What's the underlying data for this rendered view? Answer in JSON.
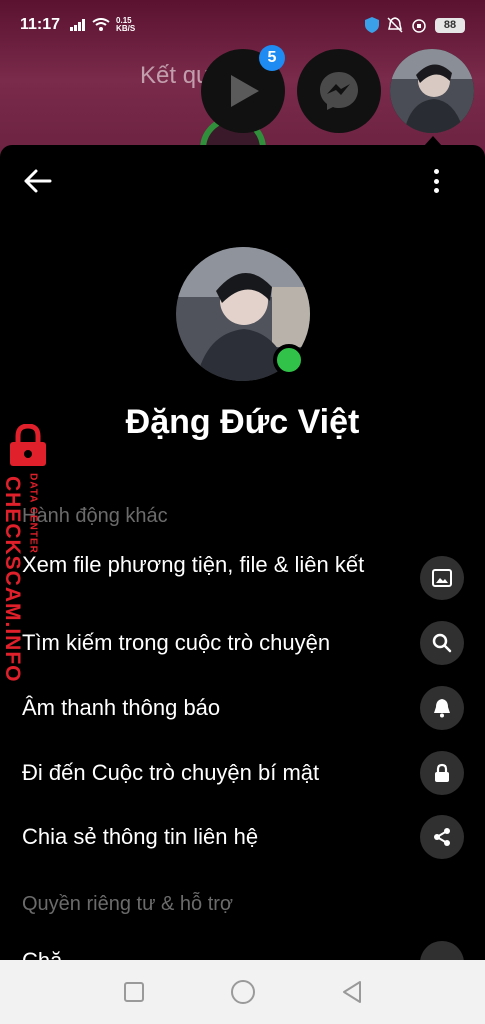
{
  "status_bar": {
    "time": "11:17",
    "speed_value": "0.15",
    "speed_unit": "KB/S",
    "battery": "88"
  },
  "background": {
    "faded_text": "Kết qu"
  },
  "chat_heads": {
    "badge_count": "5"
  },
  "profile": {
    "name": "Đặng Đức Việt"
  },
  "sections": {
    "other_actions_title": "Hành động khác",
    "privacy_title": "Quyền riêng tư & hỗ trợ"
  },
  "actions": [
    {
      "label": "Xem file phương tiện, file & liên kết",
      "icon": "image-icon"
    },
    {
      "label": "Tìm kiếm trong cuộc trò chuyện",
      "icon": "search-icon"
    },
    {
      "label": "Âm thanh thông báo",
      "icon": "bell-icon"
    },
    {
      "label": "Đi đến Cuộc trò chuyện bí mật",
      "icon": "lock-icon"
    },
    {
      "label": "Chia sẻ thông tin liên hệ",
      "icon": "share-icon"
    }
  ],
  "privacy_partial_label": "Chặ",
  "watermark": {
    "brand": "CHECKSCAM.INFO",
    "sub": "DATA CENTER"
  },
  "colors": {
    "online": "#31c24a",
    "badge": "#1d8bf1",
    "icon_bg": "#303030",
    "watermark": "#e0202a"
  }
}
